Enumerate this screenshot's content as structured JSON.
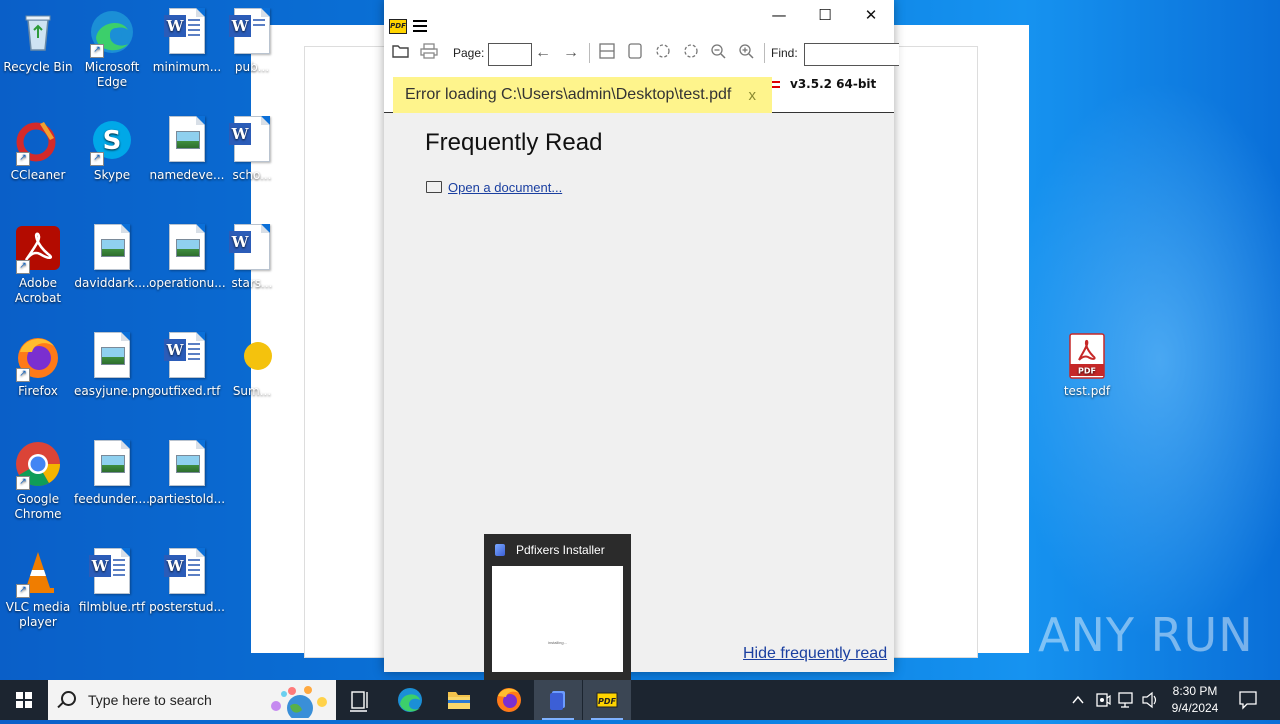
{
  "desktop": {
    "icons": [
      {
        "label": "Recycle Bin"
      },
      {
        "label": "Microsoft Edge"
      },
      {
        "label": "minimum..."
      },
      {
        "label": "pub..."
      },
      {
        "label": "CCleaner"
      },
      {
        "label": "Skype"
      },
      {
        "label": "namedeve..."
      },
      {
        "label": "scho..."
      },
      {
        "label": "Adobe Acrobat"
      },
      {
        "label": "daviddark...."
      },
      {
        "label": "operationu..."
      },
      {
        "label": "stars..."
      },
      {
        "label": "Firefox"
      },
      {
        "label": "easyjune.png"
      },
      {
        "label": "outfixed.rtf"
      },
      {
        "label": "Sum..."
      },
      {
        "label": "Google Chrome"
      },
      {
        "label": "feedunder...."
      },
      {
        "label": "partiestold..."
      },
      {
        "label": "VLC media player"
      },
      {
        "label": "filmblue.rtf"
      },
      {
        "label": "posterstud..."
      },
      {
        "label": "test.pdf"
      }
    ]
  },
  "window": {
    "minimize": "—",
    "maximize": "☐",
    "close": "✕",
    "toolbar": {
      "page_label": "Page:",
      "page_value": "",
      "find_label": "Find:",
      "find_value": ""
    },
    "version": "v3.5.2 64-bit",
    "error": {
      "message": "Error loading C:\\Users\\admin\\Desktop\\test.pdf",
      "close": "x"
    },
    "frequently_read_title": "Frequently Read",
    "open_document_link": "Open a document...",
    "hide_frequently_read": "Hide frequently read"
  },
  "thumbnail": {
    "title": "Pdfixers Installer",
    "preview_text": "installing..."
  },
  "taskbar": {
    "search_placeholder": "Type here to search",
    "time": "8:30 PM",
    "date": "9/4/2024"
  },
  "watermark": "ANY RUN",
  "colors": {
    "error_bg": "#fef48c",
    "link": "#1a3fa0",
    "taskbar": "#1c2530"
  }
}
